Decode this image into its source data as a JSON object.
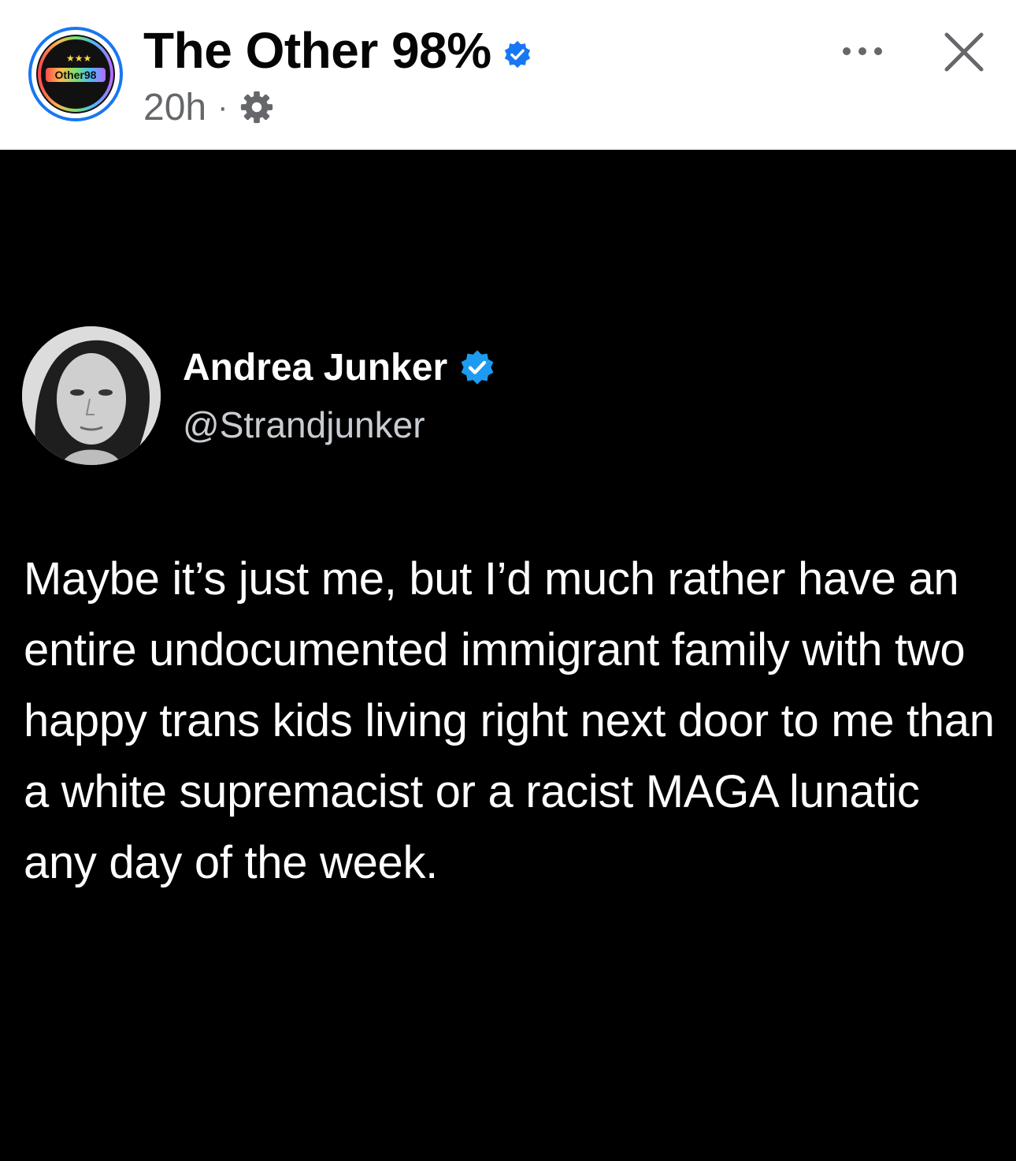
{
  "header": {
    "page_avatar_text": "Other98",
    "page_name": "The Other 98%",
    "post_time": "20h",
    "separator": "·",
    "icons": {
      "verified": "verified-badge-icon",
      "privacy": "gear-icon",
      "more": "more-options-icon",
      "close": "close-icon"
    }
  },
  "tweet": {
    "author_name": "Andrea Junker",
    "handle": "@Strandjunker",
    "text": "Maybe it’s just me, but I’d much rather have an entire undocumented immigrant family with two happy trans kids living right next door to me than a white supremacist or a racist MAGA lunatic any day of the week.",
    "icons": {
      "verified": "verified-badge-icon"
    }
  },
  "colors": {
    "header_bg": "#ffffff",
    "content_bg": "#000000",
    "facebook_blue": "#1877f2",
    "twitter_blue": "#1d9bf0",
    "meta_gray": "#65676b"
  }
}
